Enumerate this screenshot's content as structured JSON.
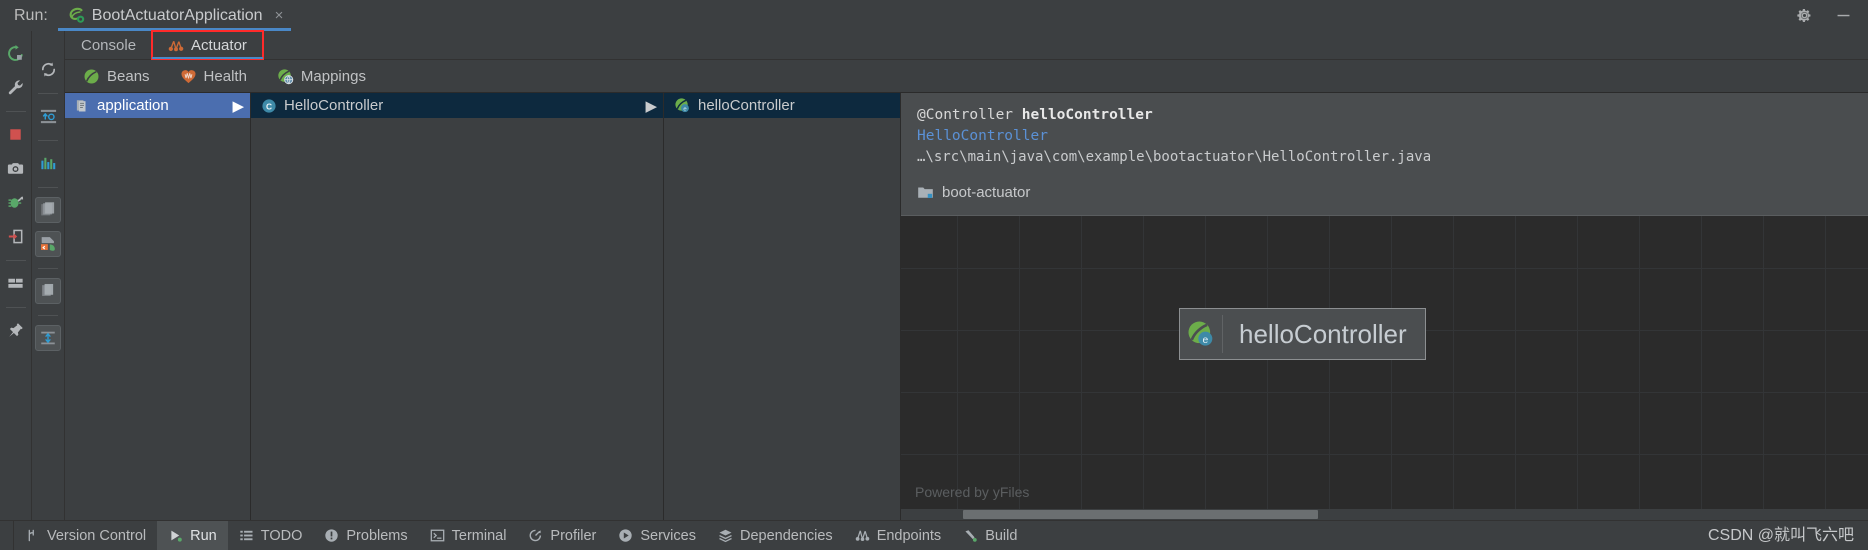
{
  "run_header": {
    "run_label": "Run:",
    "tab": {
      "title": "BootActuatorApplication",
      "close": "×",
      "icon": "spring-boot-icon"
    },
    "settings_icon": "gear-icon",
    "minimize_icon": "minimize-icon"
  },
  "left_toolbar_a": [
    {
      "name": "rerun-icon",
      "label": "Rerun"
    },
    {
      "name": "wrench-icon",
      "label": "Edit Configuration"
    },
    {
      "name": "stop-icon",
      "label": "Stop"
    },
    {
      "name": "camera-icon",
      "label": "Capture Snapshot"
    },
    {
      "name": "debug-attach-icon",
      "label": "Attach Debugger"
    },
    {
      "name": "exit-icon",
      "label": "Exit"
    },
    {
      "name": "layout-icon",
      "label": "Layout Settings"
    },
    {
      "name": "pin-icon",
      "label": "Pin Tab"
    }
  ],
  "left_toolbar_b": [
    {
      "name": "refresh-icon",
      "label": "Refresh"
    },
    {
      "name": "soft-wrap-icon",
      "label": "Soft-Wrap"
    },
    {
      "name": "chart-bars-icon",
      "label": "Chart"
    },
    {
      "name": "copy-icon",
      "label": "Copy"
    },
    {
      "name": "scroll-end-icon",
      "label": "Scroll to End"
    },
    {
      "name": "print-icon",
      "label": "Print"
    },
    {
      "name": "expand-icon",
      "label": "Expand"
    }
  ],
  "inner_tabs": [
    {
      "label": "Console",
      "selected": false,
      "icon": "console-icon",
      "highlighted": false
    },
    {
      "label": "Actuator",
      "selected": true,
      "icon": "actuator-icon",
      "highlighted": true
    }
  ],
  "endpoints": [
    {
      "label": "Beans",
      "icon": "beans-icon"
    },
    {
      "label": "Health",
      "icon": "health-heart-icon"
    },
    {
      "label": "Mappings",
      "icon": "mappings-icon"
    }
  ],
  "columns": [
    {
      "name": "application-column",
      "rows": [
        {
          "label": "application",
          "icon": "application-icon",
          "state": "sel-active",
          "arrow": "▶"
        }
      ]
    },
    {
      "name": "class-column",
      "rows": [
        {
          "label": "HelloController",
          "icon": "class-c-icon",
          "state": "sel-inactive",
          "arrow": "▶"
        }
      ]
    },
    {
      "name": "bean-column",
      "rows": [
        {
          "label": "helloController",
          "icon": "bean-icon",
          "state": "sel-inactive",
          "arrow": ""
        }
      ]
    }
  ],
  "detail": {
    "annotation_prefix": "@Controller ",
    "bean_name": "helloController",
    "type_link": "HelloController",
    "file_path": "…\\src\\main\\java\\com\\example\\bootactuator\\HelloController.java",
    "module": {
      "label": "boot-actuator",
      "icon": "module-folder-icon"
    }
  },
  "graph": {
    "node": {
      "label": "helloController",
      "icon": "bean-icon"
    },
    "watermark": "Powered by yFiles",
    "scrollbar": "horizontal-scrollbar"
  },
  "statusbar": {
    "items": [
      {
        "label": "Version Control",
        "icon": "branch-icon",
        "active": false
      },
      {
        "label": "Run",
        "icon": "run-play-icon",
        "active": true
      },
      {
        "label": "TODO",
        "icon": "todo-list-icon",
        "active": false
      },
      {
        "label": "Problems",
        "icon": "problems-icon",
        "active": false
      },
      {
        "label": "Terminal",
        "icon": "terminal-icon",
        "active": false
      },
      {
        "label": "Profiler",
        "icon": "profiler-icon",
        "active": false
      },
      {
        "label": "Services",
        "icon": "services-icon",
        "active": false
      },
      {
        "label": "Dependencies",
        "icon": "dependencies-icon",
        "active": false
      },
      {
        "label": "Endpoints",
        "icon": "endpoints-icon",
        "active": false
      },
      {
        "label": "Build",
        "icon": "build-hammer-icon",
        "active": false
      }
    ],
    "watermark": "CSDN @就叫飞六吧"
  },
  "colors": {
    "accent_blue": "#4a88c7",
    "selection_blue": "#4b6eaf",
    "inactive_selection": "#0d293e",
    "highlight_red": "#ff2a2a",
    "bean_green": "#6cad4a",
    "link_blue": "#5b91d6",
    "panel_bg": "#3c3f41",
    "detail_bg": "#4a4d4f",
    "graph_bg": "#2b2b2b"
  }
}
